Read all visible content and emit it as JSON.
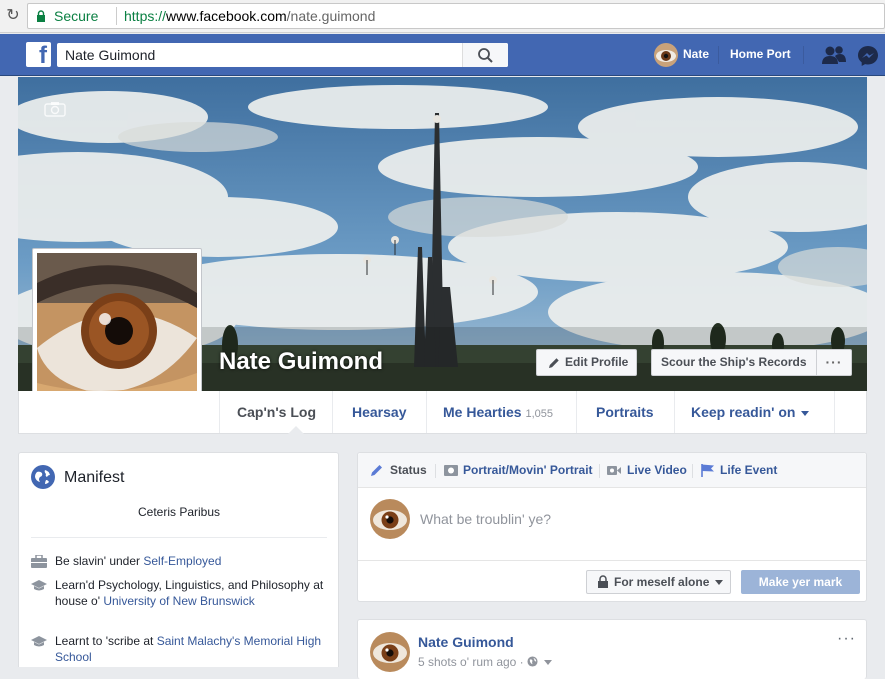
{
  "browser": {
    "secure_label": "Secure",
    "url_scheme": "https://",
    "url_host": "www.facebook.com",
    "url_path": "/nate.guimond"
  },
  "topbar": {
    "logo": "f",
    "search_value": "Nate Guimond",
    "user_name": "Nate",
    "home_label": "Home Port"
  },
  "profile": {
    "name": "Nate Guimond",
    "edit_profile_label": "Edit Profile",
    "records_label": "Scour the Ship's Records",
    "more_label": "···"
  },
  "tabs": [
    {
      "label": "Cap'n's Log"
    },
    {
      "label": "Hearsay"
    },
    {
      "label": "Me Hearties",
      "count": "1,055"
    },
    {
      "label": "Portraits"
    },
    {
      "label": "Keep readin' on"
    }
  ],
  "manifest": {
    "title": "Manifest",
    "bio": "Ceteris Paribus",
    "work_prefix": "Be slavin' under ",
    "work_link": "Self-Employed",
    "study_prefix": "Learn'd Psychology, Linguistics, and Philosophy at house o' ",
    "study_link": "University of New Brunswick",
    "school_prefix": "Learnt to 'scribe at ",
    "school_link": "Saint Malachy's Memorial High School"
  },
  "composer": {
    "tab_status": "Status",
    "tab_photo": "Portrait/Movin' Portrait",
    "tab_video": "Live Video",
    "tab_event": "Life Event",
    "placeholder": "What be troublin' ye?",
    "privacy_label": "For meself alone",
    "post_label": "Make yer mark"
  },
  "post": {
    "author": "Nate Guimond",
    "meta": "5 shots o' rum ago · ",
    "more": "···"
  },
  "colors": {
    "fb_blue": "#4267b2",
    "link": "#365899",
    "secure_green": "#0b8043"
  }
}
